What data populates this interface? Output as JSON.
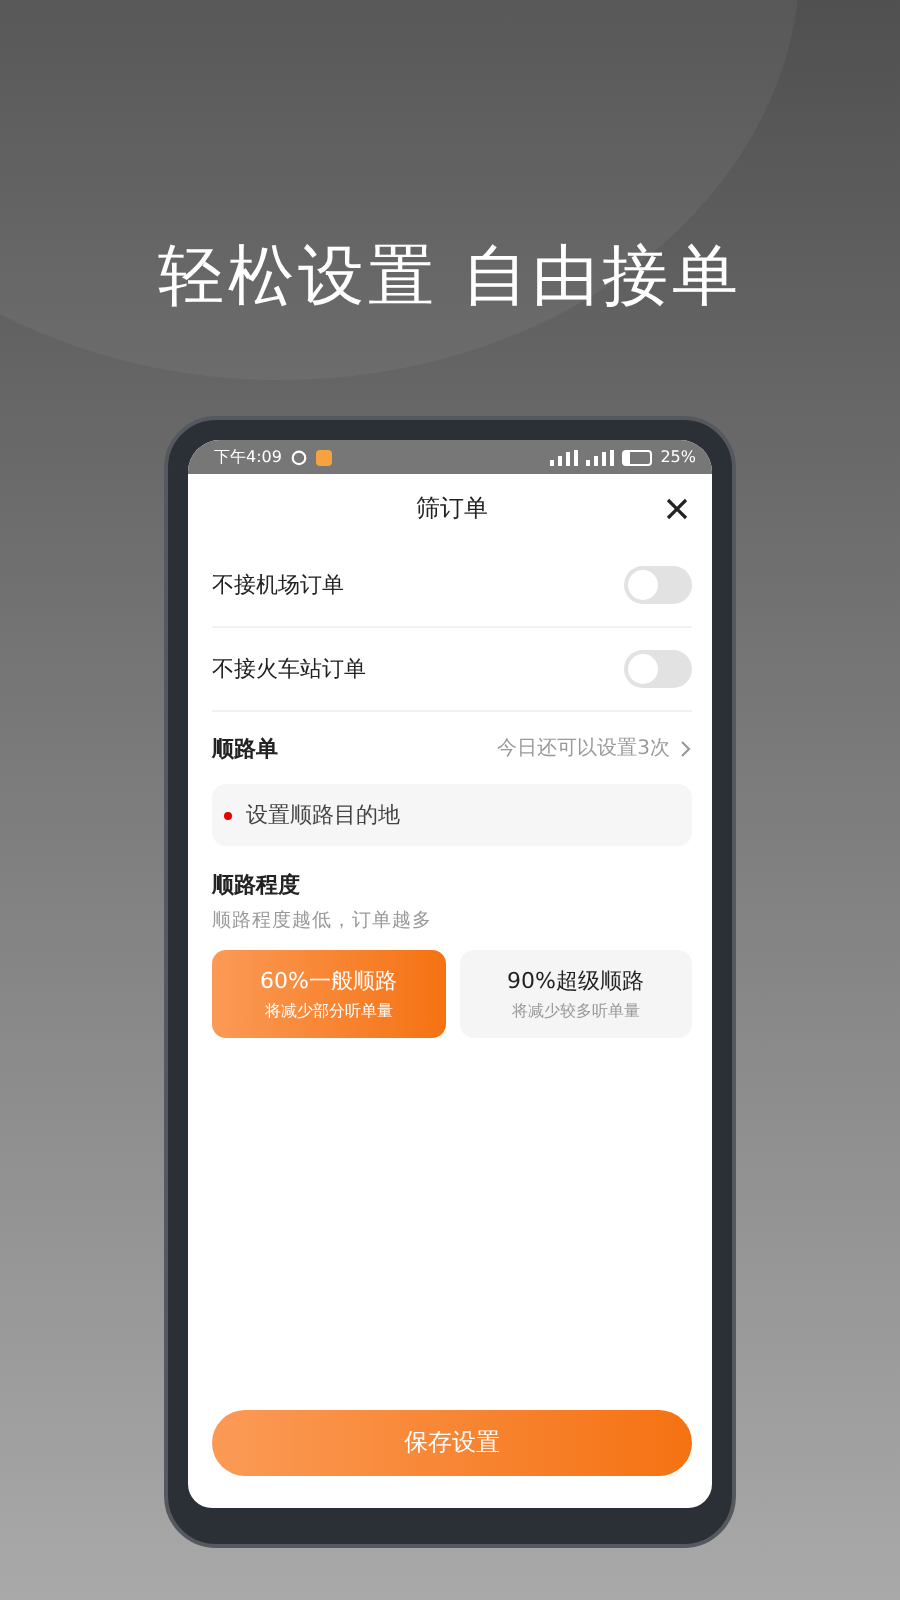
{
  "headline": "轻松设置 自由接单",
  "status_bar": {
    "time": "下午4:09",
    "battery_text": "25%"
  },
  "sheet": {
    "title": "筛订单"
  },
  "toggles": [
    {
      "label": "不接机场订单",
      "on": false
    },
    {
      "label": "不接火车站订单",
      "on": false
    }
  ],
  "route": {
    "title": "顺路单",
    "hint": "今日还可以设置3次",
    "destination_placeholder": "设置顺路目的地"
  },
  "degree": {
    "title": "顺路程度",
    "subtitle": "顺路程度越低，订单越多",
    "options": [
      {
        "title": "60%一般顺路",
        "note": "将减少部分听单量",
        "selected": true
      },
      {
        "title": "90%超级顺路",
        "note": "将减少较多听单量",
        "selected": false
      }
    ]
  },
  "save_button": "保存设置"
}
